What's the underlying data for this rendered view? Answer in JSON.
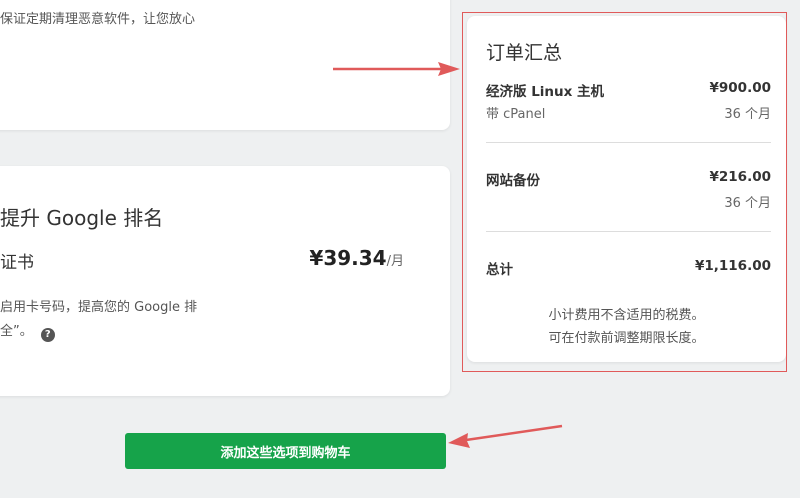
{
  "top_card": {
    "description": "保证定期清理恶意软件，让您放心"
  },
  "seo_card": {
    "title": "提升 Google 排名",
    "item_name": "证书",
    "price": "¥39.34",
    "price_unit": "/月",
    "desc_line1": "启用卡号码，提高您的 Google 排",
    "desc_line2": "全”。",
    "help_icon": "question-circle-icon"
  },
  "order_summary": {
    "title": "订单汇总",
    "items": [
      {
        "label": "经济版 Linux 主机",
        "sub": "带 cPanel",
        "price": "¥900.00",
        "term": "36 个月"
      },
      {
        "label": "网站备份",
        "sub": "",
        "price": "¥216.00",
        "term": "36 个月"
      }
    ],
    "total_label": "总计",
    "total_value": "¥1,116.00",
    "note_line1": "小计费用不含适用的税费。",
    "note_line2": "可在付款前调整期限长度。"
  },
  "actions": {
    "add_to_cart_label": "添加这些选项到购物车"
  },
  "colors": {
    "button": "#16a34a",
    "annotation_red": "#e05a5a"
  }
}
